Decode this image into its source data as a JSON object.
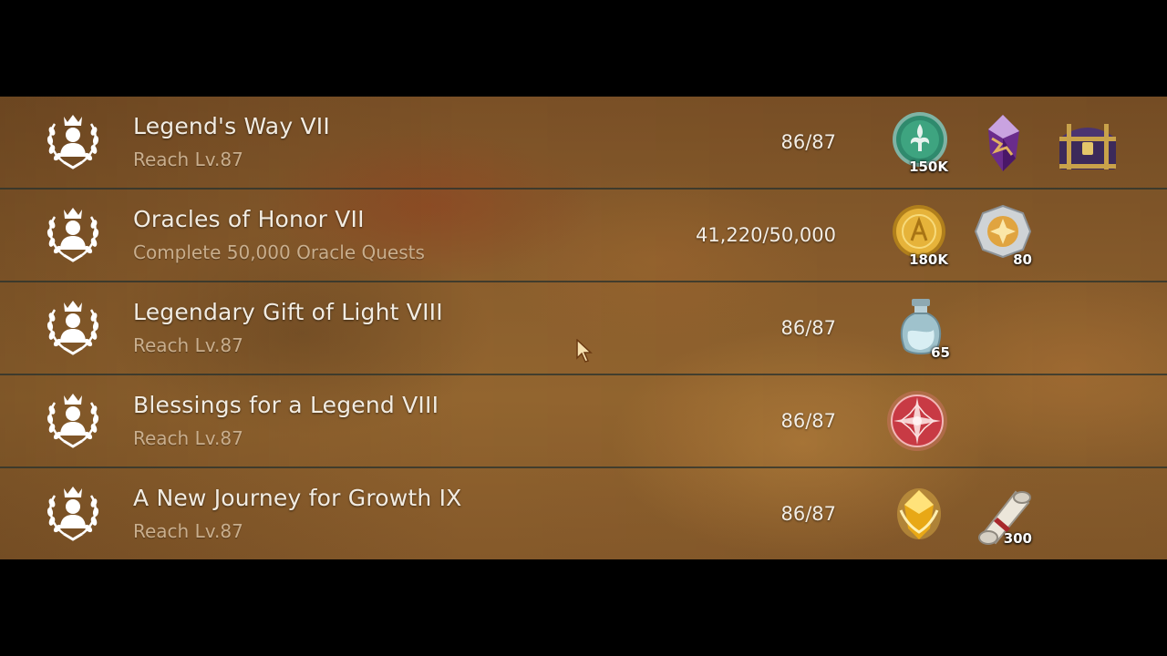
{
  "achievements": [
    {
      "title": "Legend's Way VII",
      "description": "Reach Lv.87",
      "progress": "86/87",
      "rewards": [
        {
          "icon": "fleur-de-lis-coin-icon",
          "count": "150K"
        },
        {
          "icon": "purple-crystal-icon",
          "count": ""
        },
        {
          "icon": "treasure-chest-icon",
          "count": ""
        }
      ]
    },
    {
      "title": "Oracles of Honor VII",
      "description": "Complete 50,000 Oracle Quests",
      "progress": "41,220/50,000",
      "rewards": [
        {
          "icon": "gold-coin-icon",
          "count": "180K"
        },
        {
          "icon": "silver-star-medal-icon",
          "count": "80"
        }
      ]
    },
    {
      "title": "Legendary Gift of Light VIII",
      "description": "Reach Lv.87",
      "progress": "86/87",
      "rewards": [
        {
          "icon": "potion-bottle-icon",
          "count": "65"
        }
      ]
    },
    {
      "title": "Blessings for a Legend VIII",
      "description": "Reach Lv.87",
      "progress": "86/87",
      "rewards": [
        {
          "icon": "red-compass-star-icon",
          "count": ""
        }
      ]
    },
    {
      "title": "A New Journey for Growth IX",
      "description": "Reach Lv.87",
      "progress": "86/87",
      "rewards": [
        {
          "icon": "golden-crest-icon",
          "count": ""
        },
        {
          "icon": "scroll-icon",
          "count": "300"
        }
      ]
    }
  ],
  "colors": {
    "title_text": "#f2ece2",
    "subtitle_text": "#c9ae8d",
    "panel_brown": "#8a5d2c",
    "row_divider": "#28322d"
  }
}
